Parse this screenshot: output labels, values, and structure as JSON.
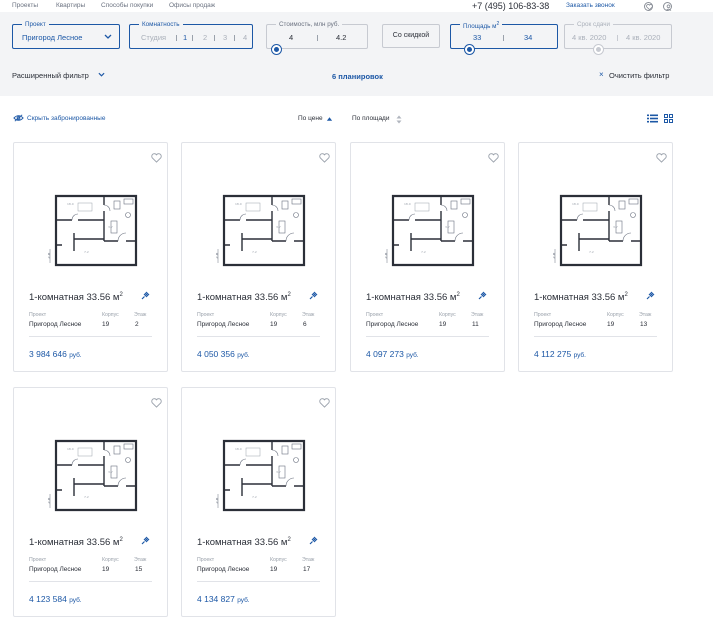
{
  "nav": {
    "links": [
      "Проекты",
      "Квартиры",
      "Способы покупки",
      "Офисы продаж"
    ],
    "phone": "+7 (495) 106-83-38",
    "callback": "Заказать звонок"
  },
  "filters": {
    "project": {
      "label": "Проект",
      "value": "Пригород Лесное"
    },
    "rooms": {
      "label": "Комнатность",
      "options": [
        "Студия",
        "1",
        "2",
        "3",
        "4"
      ],
      "selected": "1"
    },
    "cost": {
      "label": "Стоимость, млн руб.",
      "min": "4",
      "max": "4.2"
    },
    "discount_label": "Со скидкой",
    "area": {
      "label": "Площадь м",
      "label_sup": "2",
      "min": "33",
      "max": "34"
    },
    "delivery": {
      "label": "Срок сдачи",
      "min": "4 кв. 2020",
      "max": "4 кв. 2020"
    },
    "advanced_label": "Расширенный фильтр",
    "count_label": "6 планировок",
    "clear_label": "Очистить фильтр"
  },
  "toolbar": {
    "hide_booked": "Скрыть забронированные",
    "sort_price": "По цене",
    "sort_area": "По площади"
  },
  "card_meta_labels": {
    "project": "Проект",
    "building": "Корпус",
    "floor": "Этаж"
  },
  "cards": [
    {
      "title": "1-комнатная 33.56 м",
      "sup": "2",
      "project": "Пригород Лесное",
      "building": "19",
      "floor": "2",
      "price": "3 984 646",
      "currency": "руб."
    },
    {
      "title": "1-комнатная 33.56 м",
      "sup": "2",
      "project": "Пригород Лесное",
      "building": "19",
      "floor": "6",
      "price": "4 050 356",
      "currency": "руб."
    },
    {
      "title": "1-комнатная 33.56 м",
      "sup": "2",
      "project": "Пригород Лесное",
      "building": "19",
      "floor": "11",
      "price": "4 097 273",
      "currency": "руб."
    },
    {
      "title": "1-комнатная 33.56 м",
      "sup": "2",
      "project": "Пригород Лесное",
      "building": "19",
      "floor": "13",
      "price": "4 112 275",
      "currency": "руб."
    },
    {
      "title": "1-комнатная 33.56 м",
      "sup": "2",
      "project": "Пригород Лесное",
      "building": "19",
      "floor": "15",
      "price": "4 123 584",
      "currency": "руб."
    },
    {
      "title": "1-комнатная 33.56 м",
      "sup": "2",
      "project": "Пригород Лесное",
      "building": "19",
      "floor": "17",
      "price": "4 134 827",
      "currency": "руб."
    }
  ],
  "colors": {
    "accent": "#1d58a6",
    "filter_bg": "#f3f4f6",
    "text": "#2b2f38",
    "muted": "#9aa1ab"
  }
}
